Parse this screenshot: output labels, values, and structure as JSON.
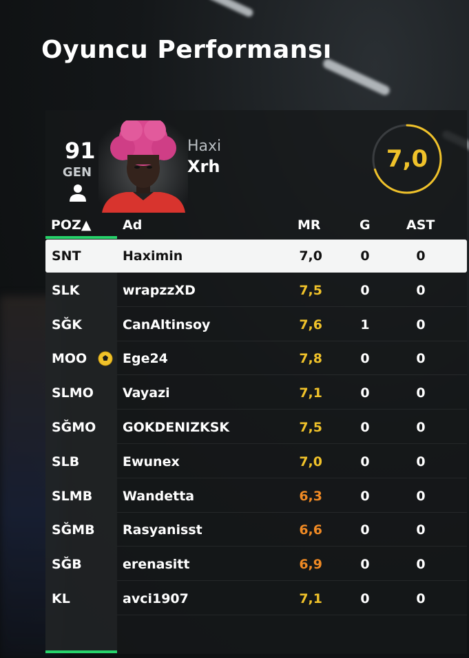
{
  "title": "Oyuncu Performansı",
  "player": {
    "rating": "91",
    "rating_label": "GEN",
    "first_name": "Haxi",
    "last_name": "Xrh",
    "match_rating": "7,0"
  },
  "columns": {
    "pos": "POZ▲",
    "name": "Ad",
    "mr": "MR",
    "g": "G",
    "ast": "AST"
  },
  "rows": [
    {
      "pos": "SNT",
      "name": "Haximin",
      "mr": "7,0",
      "g": "0",
      "ast": "0",
      "selected": true
    },
    {
      "pos": "SLK",
      "name": "wrapzzXD",
      "mr": "7,5",
      "g": "0",
      "ast": "0"
    },
    {
      "pos": "SĞK",
      "name": "CanAltinsoy",
      "mr": "7,6",
      "g": "1",
      "ast": "0"
    },
    {
      "pos": "MOO",
      "name": "Ege24",
      "mr": "7,8",
      "g": "0",
      "ast": "0",
      "motm": true
    },
    {
      "pos": "SLMO",
      "name": "Vayazi",
      "mr": "7,1",
      "g": "0",
      "ast": "0"
    },
    {
      "pos": "SĞMO",
      "name": "GOKDENIZKSK",
      "mr": "7,5",
      "g": "0",
      "ast": "0"
    },
    {
      "pos": "SLB",
      "name": "Ewunex",
      "mr": "7,0",
      "g": "0",
      "ast": "0"
    },
    {
      "pos": "SLMB",
      "name": "Wandetta",
      "mr": "6,3",
      "g": "0",
      "ast": "0"
    },
    {
      "pos": "SĞMB",
      "name": "Rasyanisst",
      "mr": "6,6",
      "g": "0",
      "ast": "0"
    },
    {
      "pos": "SĞB",
      "name": "erenasitt",
      "mr": "6,9",
      "g": "0",
      "ast": "0"
    },
    {
      "pos": "KL",
      "name": "avci1907",
      "mr": "7,1",
      "g": "0",
      "ast": "0"
    }
  ],
  "colors": {
    "accent": "#27d36b",
    "good": "#f0c22a",
    "mid": "#f08a24"
  }
}
